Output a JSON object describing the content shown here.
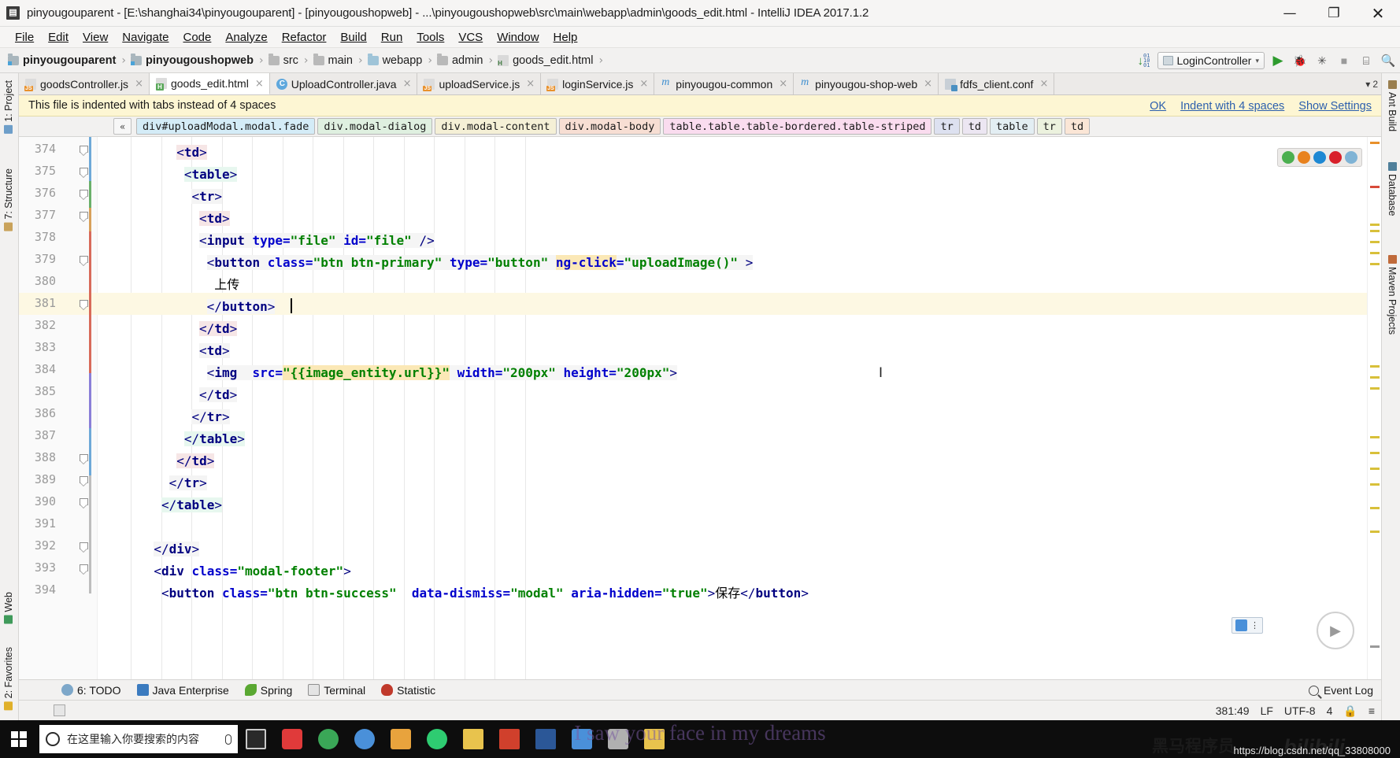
{
  "window": {
    "app_icon_glyph": "▤",
    "title": "pinyougouparent - [E:\\shanghai34\\pinyougouparent] - [pinyougoushopweb] - ...\\pinyougoushopweb\\src\\main\\webapp\\admin\\goods_edit.html - IntelliJ IDEA 2017.1.2",
    "minimize": "—",
    "maximize": "❐",
    "close": "✕"
  },
  "menubar": {
    "items": [
      {
        "label": "File"
      },
      {
        "label": "Edit"
      },
      {
        "label": "View"
      },
      {
        "label": "Navigate"
      },
      {
        "label": "Code"
      },
      {
        "label": "Analyze"
      },
      {
        "label": "Refactor"
      },
      {
        "label": "Build"
      },
      {
        "label": "Run"
      },
      {
        "label": "Tools"
      },
      {
        "label": "VCS"
      },
      {
        "label": "Window"
      },
      {
        "label": "Help"
      }
    ]
  },
  "navbar": {
    "crumbs": [
      {
        "label": "pinyougouparent",
        "icon": "module-folder-icon",
        "bold": true
      },
      {
        "label": "pinyougoushopweb",
        "icon": "module-folder-icon",
        "bold": true
      },
      {
        "label": "src",
        "icon": "folder-icon",
        "bold": false
      },
      {
        "label": "main",
        "icon": "folder-icon",
        "bold": false
      },
      {
        "label": "webapp",
        "icon": "web-folder-icon",
        "bold": false
      },
      {
        "label": "admin",
        "icon": "folder-icon",
        "bold": false
      },
      {
        "label": "goods_edit.html",
        "icon": "html-file-icon",
        "bold": false
      }
    ],
    "separator": "›",
    "run_config": "LoginController",
    "dropdown_arrow": "▾",
    "run_icon": "▶",
    "debug_icon": "🐞",
    "coverage_icon": "✳",
    "stop_icon": "■",
    "layout_icon": "⌸",
    "search_icon": "🔍"
  },
  "tabs": {
    "items": [
      {
        "label": "goodsController.js",
        "icon": "js-file-icon",
        "active": false,
        "close": "×"
      },
      {
        "label": "goods_edit.html",
        "icon": "html-file-icon",
        "active": true,
        "close": "×"
      },
      {
        "label": "UploadController.java",
        "icon": "java-class-icon",
        "active": false,
        "close": "×"
      },
      {
        "label": "uploadService.js",
        "icon": "js-file-icon",
        "active": false,
        "close": "×"
      },
      {
        "label": "loginService.js",
        "icon": "js-file-icon",
        "active": false,
        "close": "×"
      },
      {
        "label": "pinyougou-common",
        "icon": "maven-module-icon",
        "active": false,
        "close": "×"
      },
      {
        "label": "pinyougou-shop-web",
        "icon": "maven-module-icon",
        "active": false,
        "close": "×"
      },
      {
        "label": "fdfs_client.conf",
        "icon": "conf-file-icon",
        "active": false,
        "close": "×"
      }
    ],
    "overflow_label": "2",
    "overflow_arrow": "▾"
  },
  "notification": {
    "message": "This file is indented with tabs instead of 4 spaces",
    "ok_label": "OK",
    "indent_label": "Indent with 4 spaces",
    "settings_label": "Show Settings"
  },
  "structure_chips": {
    "collapse_label": "«",
    "items": [
      {
        "label": "div#uploadModal.modal.fade",
        "color": "#d4ecf7"
      },
      {
        "label": "div.modal-dialog",
        "color": "#dff0e0"
      },
      {
        "label": "div.modal-content",
        "color": "#f5f0d6"
      },
      {
        "label": "div.modal-body",
        "color": "#f7ded3"
      },
      {
        "label": "table.table.table-bordered.table-striped",
        "color": "#fadcef"
      },
      {
        "label": "tr",
        "color": "#dde1f0"
      },
      {
        "label": "td",
        "color": "#ece6f2"
      },
      {
        "label": "table",
        "color": "#e3eef3"
      },
      {
        "label": "tr",
        "color": "#ecf2de"
      },
      {
        "label": "td",
        "color": "#fbe6d6"
      }
    ]
  },
  "editor": {
    "first_line": 374,
    "caret_line": 381,
    "lines": [
      {
        "n": 374,
        "indent": 10,
        "fold": true,
        "html": "&lt;td&gt;",
        "hl": "hi-a"
      },
      {
        "n": 375,
        "indent": 11,
        "fold": true,
        "html": "&lt;table&gt;",
        "hl": "hi-b"
      },
      {
        "n": 376,
        "indent": 12,
        "fold": true,
        "html": "&lt;tr&gt;",
        "hl": "hi-c"
      },
      {
        "n": 377,
        "indent": 13,
        "fold": true,
        "html": "&lt;td&gt;",
        "hl": "hi-a"
      },
      {
        "n": 378,
        "indent": 13,
        "fold": false,
        "html": "&lt;input type=\"file\" id=\"file\" /&gt;",
        "hl": "hi-tag"
      },
      {
        "n": 379,
        "indent": 14,
        "fold": true,
        "html": "&lt;button class=\"btn btn-primary\" type=\"button\" ng-click=\"uploadImage()\" &gt;",
        "hl": "hi-tag"
      },
      {
        "n": 380,
        "indent": 15,
        "fold": false,
        "html": "上传",
        "hl": ""
      },
      {
        "n": 381,
        "indent": 14,
        "fold": true,
        "html": "&lt;/button&gt;",
        "hl": "hi-tag"
      },
      {
        "n": 382,
        "indent": 13,
        "fold": false,
        "html": "&lt;/td&gt;",
        "hl": "hi-a"
      },
      {
        "n": 383,
        "indent": 13,
        "fold": false,
        "html": "&lt;td&gt;",
        "hl": "hi-c"
      },
      {
        "n": 384,
        "indent": 14,
        "fold": false,
        "html": "&lt;img  src=\"{{image_entity.url}}\" width=\"200px\" height=\"200px\"&gt;",
        "hl": "hi-tag"
      },
      {
        "n": 385,
        "indent": 13,
        "fold": false,
        "html": "&lt;/td&gt;",
        "hl": "hi-c"
      },
      {
        "n": 386,
        "indent": 12,
        "fold": false,
        "html": "&lt;/tr&gt;",
        "hl": "hi-c"
      },
      {
        "n": 387,
        "indent": 11,
        "fold": false,
        "html": "&lt;/table&gt;",
        "hl": "hi-b"
      },
      {
        "n": 388,
        "indent": 10,
        "fold": true,
        "html": "&lt;/td&gt;",
        "hl": "hi-a"
      },
      {
        "n": 389,
        "indent": 9,
        "fold": true,
        "html": "&lt;/tr&gt;",
        "hl": "hi-c"
      },
      {
        "n": 390,
        "indent": 8,
        "fold": true,
        "html": "&lt;/table&gt;",
        "hl": "hi-b"
      },
      {
        "n": 391,
        "indent": 0,
        "fold": false,
        "html": "",
        "hl": ""
      },
      {
        "n": 392,
        "indent": 7,
        "fold": true,
        "html": "&lt;/div&gt;",
        "hl": "hi-tag"
      },
      {
        "n": 393,
        "indent": 7,
        "fold": true,
        "html": "&lt;div class=\"modal-footer\"&gt;",
        "hl": ""
      },
      {
        "n": 394,
        "indent": 8,
        "fold": false,
        "html": "&lt;button class=\"btn btn-success\"  data-dismiss=\"modal\" aria-hidden=\"true\"&gt;保存&lt;/button&gt;",
        "hl": ""
      }
    ],
    "code_tokens": {
      "tag_color": "#000080",
      "attr_color": "#0000cc",
      "value_color": "#008000",
      "text_color": "#000000",
      "ng_click_highlight": "#fbe8b6",
      "binding_highlight": "#fbe8b6"
    }
  },
  "left_toolwindows": [
    {
      "label": "1: Project",
      "icon": "project-icon"
    },
    {
      "label": "7: Structure",
      "icon": "structure-icon"
    },
    {
      "label": "Web",
      "icon": "web-icon"
    },
    {
      "label": "2: Favorites",
      "icon": "favorites-icon"
    }
  ],
  "right_toolwindows": [
    {
      "label": "Ant Build",
      "icon": "ant-icon"
    },
    {
      "label": "Database",
      "icon": "database-icon"
    },
    {
      "label": "Maven Projects",
      "icon": "maven-icon"
    }
  ],
  "bottom_toolwindows": [
    {
      "label": "6: TODO",
      "icon": "todo-icon",
      "color": "#7da7c9"
    },
    {
      "label": "Java Enterprise",
      "icon": "java-enterprise-icon",
      "color": "#3b7bbf"
    },
    {
      "label": "Spring",
      "icon": "spring-icon",
      "color": "#5aa832"
    },
    {
      "label": "Terminal",
      "icon": "terminal-icon",
      "color": "#8e8e8e"
    },
    {
      "label": "Statistic",
      "icon": "statistic-icon",
      "color": "#c0392b"
    }
  ],
  "event_log": {
    "label": "Event Log",
    "icon": "search-log-icon"
  },
  "statusbar": {
    "caret_position": "381:49",
    "line_sep": "LF",
    "encoding": "UTF-8",
    "indent": "4",
    "lock_icon": "🔒",
    "extra": "≡"
  },
  "browser_icons": [
    {
      "name": "chrome-icon",
      "color": "#4caf50"
    },
    {
      "name": "firefox-icon",
      "color": "#e8821e"
    },
    {
      "name": "edge-icon",
      "color": "#1e88d3"
    },
    {
      "name": "opera-icon",
      "color": "#d8202a"
    },
    {
      "name": "ie-icon",
      "color": "#7fb3d5"
    }
  ],
  "taskbar": {
    "search_placeholder": "在这里输入你要搜索的内容",
    "items": [
      {
        "name": "taskview-icon",
        "color": "#c9c9c9"
      },
      {
        "name": "ide-icon",
        "color": "#f0f0f0"
      },
      {
        "name": "browser-icon",
        "color": "#3aa757"
      },
      {
        "name": "chrome-icon",
        "color": "#4a90d9"
      },
      {
        "name": "qq-icon",
        "color": "#e8a33d"
      },
      {
        "name": "music-icon",
        "color": "#2ecc71"
      },
      {
        "name": "folder-icon",
        "color": "#e8c34d"
      },
      {
        "name": "pdf-icon",
        "color": "#d0402c"
      },
      {
        "name": "word-icon",
        "color": "#2b5797"
      },
      {
        "name": "editor-icon",
        "color": "#4a90d9"
      },
      {
        "name": "ide2-icon",
        "color": "#b0b0b0"
      },
      {
        "name": "files-icon",
        "color": "#e8c34d"
      }
    ]
  },
  "watermark": {
    "text": "I saw your face in my dreams",
    "brand_cn": "黑马程序员",
    "brand_bili": "bilibili",
    "url": "https://blog.csdn.net/qq_33808000"
  }
}
